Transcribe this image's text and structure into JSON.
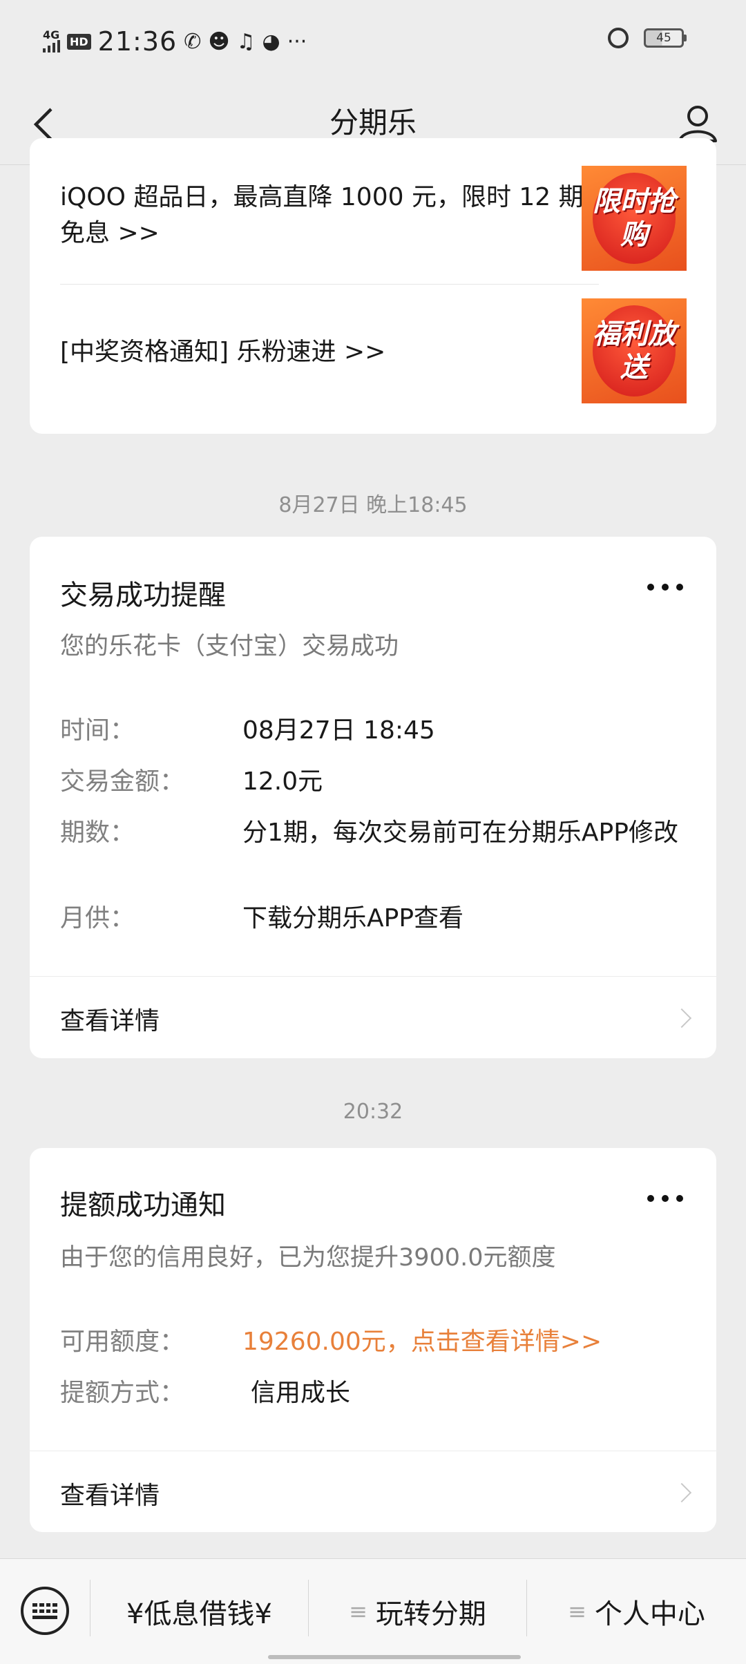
{
  "status_bar": {
    "network": "4G",
    "hd": "HD",
    "time": "21:36",
    "battery": "45"
  },
  "nav": {
    "title": "分期乐"
  },
  "promo": {
    "items": [
      {
        "text": "iQOO 超品日，最高直降 1000 元，限时 12 期免息 >>",
        "badge": "限时抢购"
      },
      {
        "text": "[中奖资格通知] 乐粉速进 >>",
        "badge": "福利放送"
      }
    ]
  },
  "messages": [
    {
      "timestamp": "8月27日 晚上18:45",
      "title": "交易成功提醒",
      "subtitle": "您的乐花卡（支付宝）交易成功",
      "rows": [
        {
          "label": "时间：",
          "value": "08月27日 18:45"
        },
        {
          "label": "交易金额：",
          "value": "12.0元"
        },
        {
          "label": "期数：",
          "value": "分1期，每次交易前可在分期乐APP修改"
        },
        {
          "label": "月供：",
          "value": "下载分期乐APP查看"
        }
      ],
      "detail": "查看详情"
    },
    {
      "timestamp": "20:32",
      "title": "提额成功通知",
      "subtitle": "由于您的信用良好，已为您提升3900.0元额度",
      "rows": [
        {
          "label": "可用额度：",
          "value": "19260.00元，点击查看详情>>"
        },
        {
          "label": "提额方式：",
          "value": "信用成长"
        }
      ],
      "detail": "查看详情"
    }
  ],
  "bottom_menu": {
    "items": [
      {
        "label": "¥低息借钱¥"
      },
      {
        "label": "玩转分期"
      },
      {
        "label": "个人中心"
      }
    ]
  },
  "colors": {
    "highlight": "#e8803a",
    "background": "#ededed"
  }
}
